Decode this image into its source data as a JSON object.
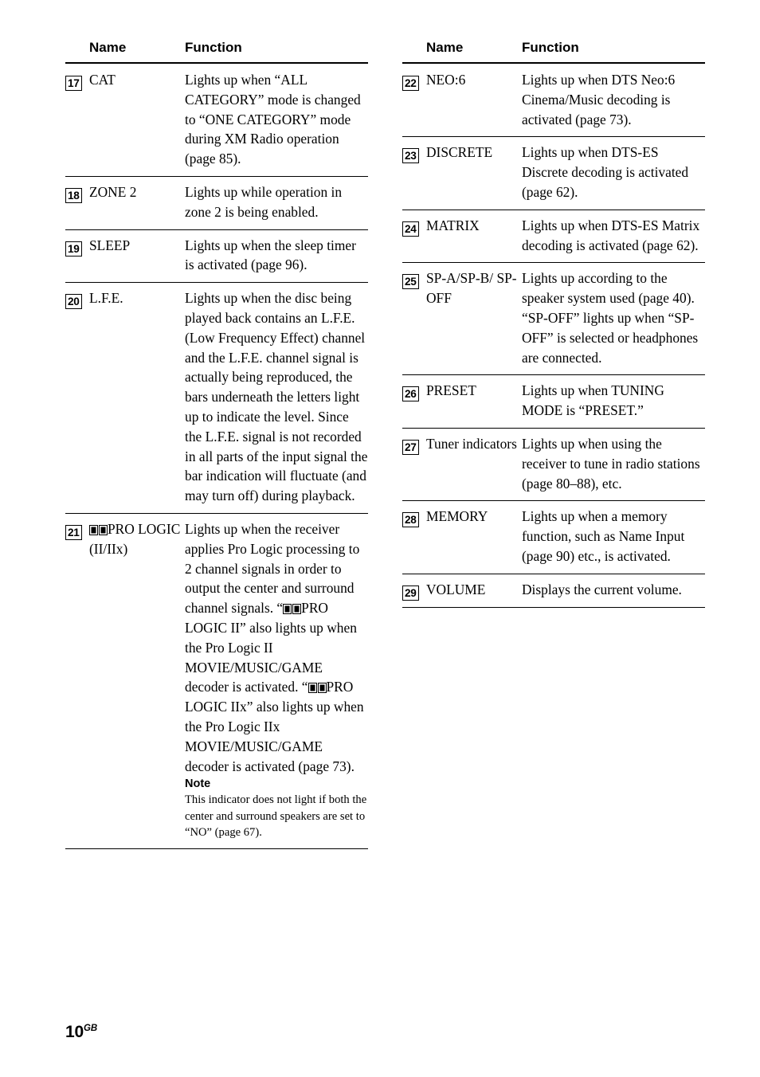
{
  "page": {
    "number": "10",
    "region_code": "GB"
  },
  "columns": [
    {
      "headers": {
        "num": "",
        "name": "Name",
        "function": "Function"
      },
      "rows": [
        {
          "badge": "17",
          "name": "CAT",
          "paragraphs": [
            "Lights up when “ALL CATEGORY” mode is changed to “ONE CATEGORY” mode during XM Radio operation (page 85)."
          ]
        },
        {
          "badge": "18",
          "name": "ZONE 2",
          "paragraphs": [
            "Lights up while operation in zone 2 is being enabled."
          ]
        },
        {
          "badge": "19",
          "name": "SLEEP",
          "paragraphs": [
            "Lights up when the sleep timer is activated (page 96)."
          ]
        },
        {
          "badge": "20",
          "name": "L.F.E.",
          "paragraphs": [
            "Lights up when the disc being played back contains an L.F.E. (Low Frequency Effect) channel and the L.F.E. channel signal is actually being reproduced, the bars underneath the letters light up to indicate the level. Since the L.F.E. signal is not recorded in all parts of the input signal the bar indication will fluctuate (and may turn off) during playback."
          ]
        },
        {
          "badge": "21",
          "name_prefix_dolby": true,
          "name": "PRO LOGIC (II/IIx)",
          "paragraphs_rich": [
            {
              "segments": [
                {
                  "text": "Lights up when the receiver applies Pro Logic processing to 2 channel signals in order to output the center and surround channel signals. “"
                },
                {
                  "dolby": true
                },
                {
                  "text": "PRO LOGIC II” also lights up when the Pro Logic II MOVIE/MUSIC/GAME decoder is activated. “"
                },
                {
                  "dolby": true
                },
                {
                  "text": "PRO LOGIC IIx” also lights up when the Pro Logic IIx MOVIE/MUSIC/GAME decoder is activated (page 73)."
                }
              ]
            }
          ],
          "note": {
            "heading": "Note",
            "body": "This indicator does not light if both the center and surround speakers are set to “NO” (page 67)."
          }
        }
      ]
    },
    {
      "headers": {
        "num": "",
        "name": "Name",
        "function": "Function"
      },
      "rows": [
        {
          "badge": "22",
          "name": "NEO:6",
          "paragraphs": [
            "Lights up when DTS Neo:6 Cinema/Music decoding is activated (page 73)."
          ]
        },
        {
          "badge": "23",
          "name": "DISCRETE",
          "paragraphs": [
            "Lights up when DTS-ES Discrete decoding is activated (page 62)."
          ]
        },
        {
          "badge": "24",
          "name": "MATRIX",
          "paragraphs": [
            "Lights up when DTS-ES Matrix decoding is activated (page 62)."
          ]
        },
        {
          "badge": "25",
          "name": "SP-A/SP-B/ SP-OFF",
          "paragraphs": [
            "Lights up according to the speaker system used (page 40).",
            "“SP-OFF” lights up when “SP-OFF” is selected or headphones are connected."
          ]
        },
        {
          "badge": "26",
          "name": "PRESET",
          "paragraphs": [
            "Lights up when TUNING MODE is “PRESET.”"
          ]
        },
        {
          "badge": "27",
          "name": "Tuner indicators",
          "paragraphs": [
            "Lights up when using the receiver to tune in radio stations (page 80–88), etc."
          ]
        },
        {
          "badge": "28",
          "name": "MEMORY",
          "paragraphs": [
            "Lights up when a memory function, such as Name Input (page 90) etc., is activated."
          ]
        },
        {
          "badge": "29",
          "name": "VOLUME",
          "paragraphs": [
            "Displays the current volume."
          ]
        }
      ]
    }
  ]
}
